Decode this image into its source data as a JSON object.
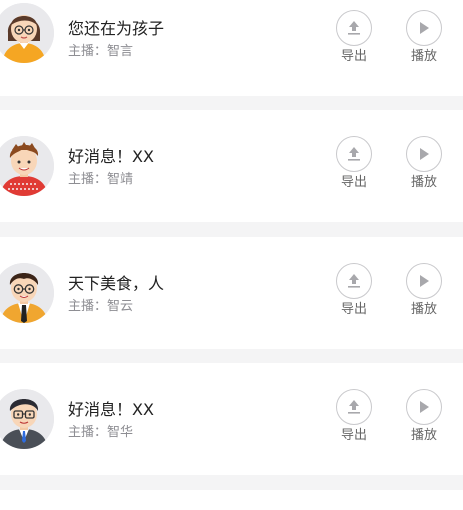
{
  "colors": {
    "background": "#f4f4f5",
    "card": "#ffffff",
    "title_text": "#222222",
    "host_text": "#8e8e93",
    "icon_stroke": "#a8a8ac"
  },
  "icons": {
    "export": "upload-arrow-icon",
    "play": "play-triangle-icon"
  },
  "items": [
    {
      "title": "您还在为孩子",
      "host": "主播：智言",
      "export_label": "导出",
      "play_label": "播放",
      "avatar": "avatar-woman-glasses"
    },
    {
      "title": "好消息！XX",
      "host": "主播：智靖",
      "export_label": "导出",
      "play_label": "播放",
      "avatar": "avatar-man-red-sweater"
    },
    {
      "title": "天下美食，人",
      "host": "主播：智云",
      "export_label": "导出",
      "play_label": "播放",
      "avatar": "avatar-man-glasses-tie"
    },
    {
      "title": "好消息！XX",
      "host": "主播：智华",
      "export_label": "导出",
      "play_label": "播放",
      "avatar": "avatar-man-glasses-suit"
    }
  ]
}
